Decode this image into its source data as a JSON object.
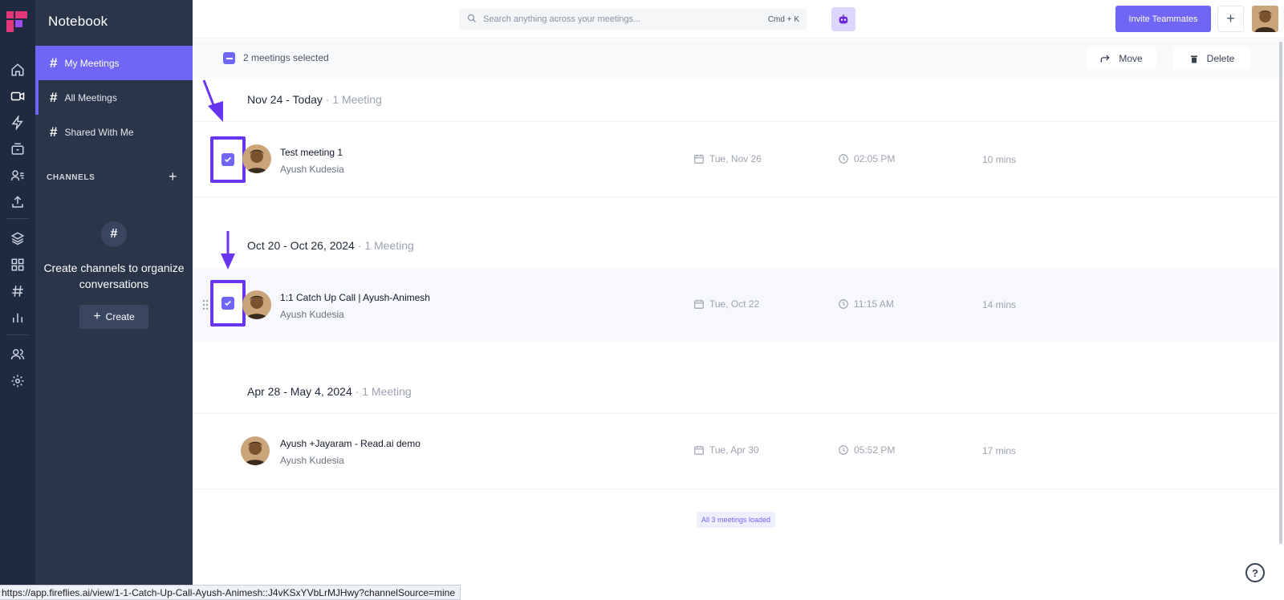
{
  "app": {
    "section_title": "Notebook",
    "accent": "#6f66f6",
    "highlight_border": "#6a35f0"
  },
  "rail": {
    "icons": [
      "home-icon",
      "video-icon",
      "bolt-icon",
      "integrations-icon",
      "contacts-icon",
      "upload-icon",
      "layers-icon",
      "apps-grid-icon",
      "channels-hash-icon",
      "analytics-icon",
      "team-icon",
      "settings-icon"
    ]
  },
  "sidebar": {
    "items": [
      {
        "label": "My Meetings",
        "active": true
      },
      {
        "label": "All Meetings",
        "active": false
      },
      {
        "label": "Shared With Me",
        "active": false
      }
    ],
    "channels_label": "CHANNELS",
    "empty_title": "Create channels to organize conversations",
    "create_label": "Create"
  },
  "topbar": {
    "search_placeholder": "Search anything across your meetings...",
    "search_shortcut": "Cmd + K",
    "invite_label": "Invite Teammates",
    "plus_label": "+"
  },
  "selection": {
    "text": "2 meetings selected",
    "move_label": "Move",
    "delete_label": "Delete"
  },
  "groups": [
    {
      "range": "Nov 24 - Today",
      "count": "1 Meeting",
      "meetings": [
        {
          "title": "Test meeting 1",
          "host": "Ayush Kudesia",
          "date": "Tue, Nov 26",
          "time": "02:05 PM",
          "duration": "10 mins",
          "selected": true
        }
      ]
    },
    {
      "range": "Oct 20 - Oct 26, 2024",
      "count": "1 Meeting",
      "meetings": [
        {
          "title": "1:1 Catch Up Call | Ayush-Animesh",
          "host": "Ayush Kudesia",
          "date": "Tue, Oct 22",
          "time": "11:15 AM",
          "duration": "14 mins",
          "selected": true
        }
      ]
    },
    {
      "range": "Apr 28 - May 4, 2024",
      "count": "1 Meeting",
      "meetings": [
        {
          "title": "Ayush +Jayaram - Read.ai demo",
          "host": "Ayush Kudesia",
          "date": "Tue, Apr 30",
          "time": "05:52 PM",
          "duration": "17 mins",
          "selected": false
        }
      ]
    }
  ],
  "footer": {
    "loaded_text": "All 3 meetings loaded",
    "status_url": "https://app.fireflies.ai/view/1-1-Catch-Up-Call-Ayush-Animesh::J4vKSxYVbLrMJHwy?channelSource=mine",
    "help_label": "?"
  }
}
